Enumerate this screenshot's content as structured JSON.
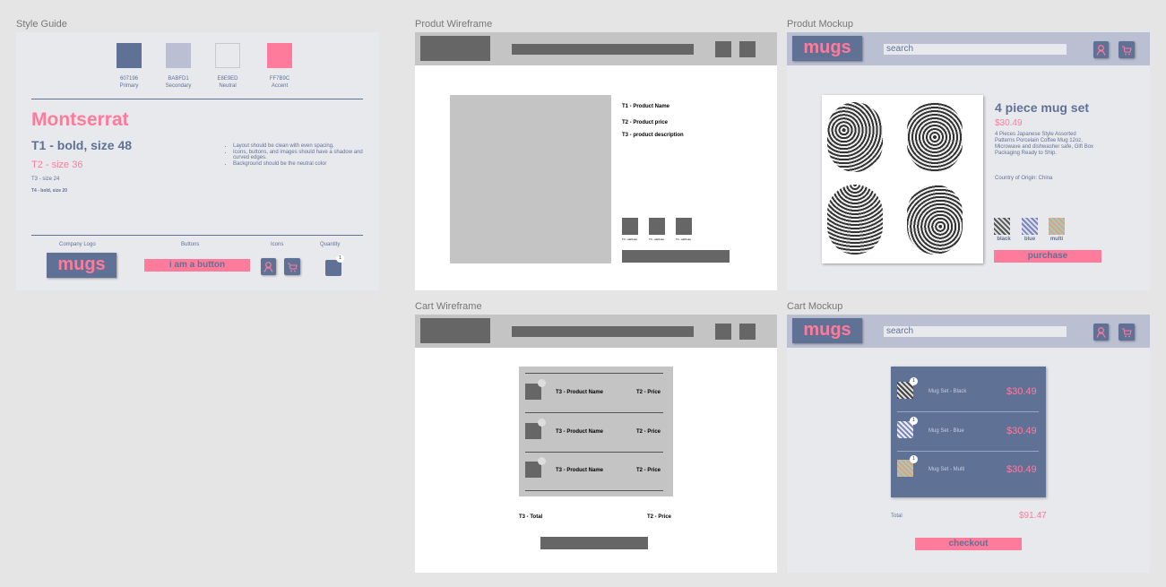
{
  "frames": {
    "style_guide": "Style Guide",
    "product_wireframe": "Produt Wireframe",
    "product_mockup": "Produt Mockup",
    "cart_wireframe": "Cart Wireframe",
    "cart_mockup": "Cart Mockup"
  },
  "colors": {
    "primary": "#607196",
    "secondary": "#BABFD1",
    "neutral": "#E8E9ED",
    "accent": "#FF7B9C"
  },
  "style_guide": {
    "swatches": [
      {
        "hex": "607196",
        "name": "Primary"
      },
      {
        "hex": "BABFD1",
        "name": "Secondary"
      },
      {
        "hex": "E8E9ED",
        "name": "Neutral"
      },
      {
        "hex": "FF7B9C",
        "name": "Accent"
      }
    ],
    "font_name": "Montserrat",
    "t1": "T1 - bold, size 48",
    "t2": "T2 - size 36",
    "t3": "T3 - size 24",
    "t4": "T4 - bold, size 20",
    "notes": [
      "Layout should be clean with even spacing.",
      "Icons, buttons, and images should have a shadow and curved edges.",
      "Background should be the neutral color"
    ],
    "labels": {
      "logo": "Company Logo",
      "buttons": "Buttons",
      "icons": "Icons",
      "quantity": "Quantity"
    },
    "logo_text": "mugs",
    "button_text": "i am a button",
    "quantity_badge": "1"
  },
  "product_wireframe": {
    "t1": "T1 - Product Name",
    "t2": "T2 - Product price",
    "t3": "T3 - product description",
    "attribute": "T4 - attribute"
  },
  "product_mockup": {
    "logo": "mugs",
    "search_placeholder": "search",
    "title": "4 piece mug set",
    "price": "$30.49",
    "description": "4 Pieces Japanese Style Assorted Patterns Porcelain Coffee Mug 12oz, Microwave and dishwasher safe, Gift Box Packaging Ready to Ship.",
    "origin": "Country of Origin: China",
    "options": [
      "black",
      "blue",
      "multi"
    ],
    "purchase": "purchase"
  },
  "cart_wireframe": {
    "rows": [
      {
        "name": "T3 - Product Name",
        "price": "T2 - Price"
      },
      {
        "name": "T3 - Product Name",
        "price": "T2 - Price"
      },
      {
        "name": "T3 - Product Name",
        "price": "T2 - Price"
      }
    ],
    "total_label": "T3 - Total",
    "total_price": "T2 - Price"
  },
  "cart_mockup": {
    "logo": "mugs",
    "search_placeholder": "search",
    "items": [
      {
        "name": "Mug Set - Black",
        "price": "$30.49",
        "qty": "1"
      },
      {
        "name": "Mug Set - Blue",
        "price": "$30.49",
        "qty": "1"
      },
      {
        "name": "Mug Set - Multi",
        "price": "$30.49",
        "qty": "1"
      }
    ],
    "total_label": "Total",
    "total": "$91.47",
    "checkout": "checkout"
  }
}
